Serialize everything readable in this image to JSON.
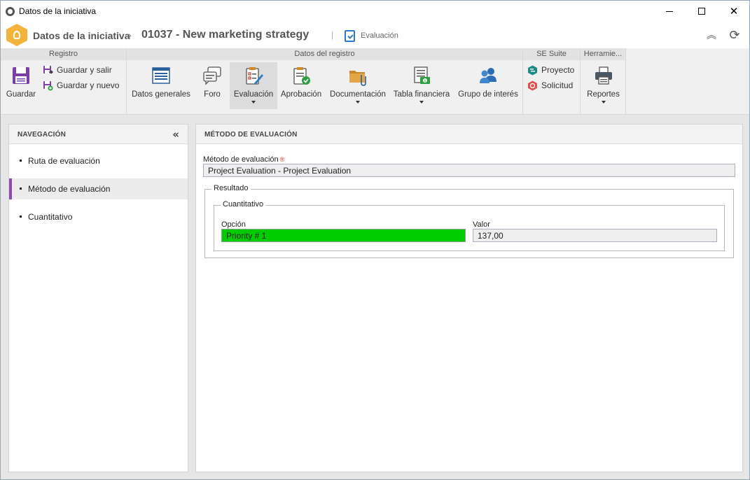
{
  "window": {
    "title": "Datos de la iniciativa",
    "minimize_icon": "minimize-icon",
    "maximize_icon": "maximize-icon",
    "close_label": "✕"
  },
  "header": {
    "breadcrumb_root": "Datos de la iniciativa",
    "breadcrumb_separator": "›",
    "record_title": "01037 - New marketing strategy",
    "section_divider": "|",
    "current_section": "Evaluación",
    "collapse_glyph": "⌃",
    "refresh_glyph": "⟳"
  },
  "ribbon": {
    "groups": {
      "registro": "Registro",
      "datos_registro": "Datos del registro",
      "se_suite": "SE Suite",
      "herramientas": "Herramie..."
    },
    "registro": {
      "save": "Guardar",
      "save_exit": "Guardar y salir",
      "save_new": "Guardar y nuevo"
    },
    "datos_registro": {
      "general": "Datos generales",
      "forum": "Foro",
      "evaluation": "Evaluación",
      "approval": "Aprobación",
      "documentation": "Documentación",
      "financial": "Tabla financiera",
      "interest_group": "Grupo de interés"
    },
    "se_suite": {
      "project": "Proyecto",
      "request": "Solicitud"
    },
    "herramientas": {
      "reports": "Reportes"
    }
  },
  "navigation": {
    "title": "NAVEGACIÓN",
    "collapse_glyph": "«",
    "items": [
      {
        "label": "Ruta de evaluación",
        "active": false
      },
      {
        "label": "Método de evaluación",
        "active": true
      },
      {
        "label": "Cuantitativo",
        "active": false
      }
    ]
  },
  "main": {
    "title": "MÉTODO DE EVALUACIÓN",
    "method_label": "Método de evaluación",
    "required_mark": "®",
    "method_value": "Project Evaluation  - Project Evaluation",
    "result_legend": "Resultado",
    "quantitative_legend": "Cuantitativo",
    "option_label": "Opción",
    "option_value": "Priority # 1",
    "option_color": "#00cc00",
    "value_label": "Valor",
    "value_value": "137,00"
  },
  "colors": {
    "accent_purple": "#8b4bb0",
    "brand_orange": "#f3b33d",
    "icon_blue": "#2a7cc7"
  }
}
